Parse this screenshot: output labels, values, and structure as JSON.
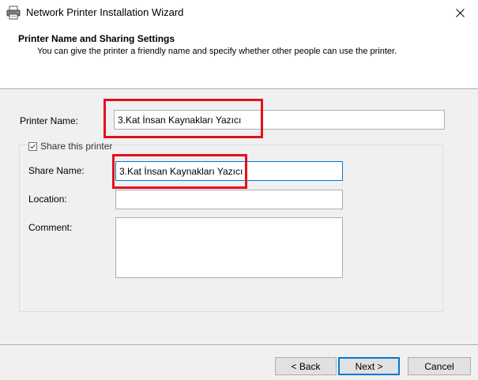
{
  "window": {
    "title": "Network Printer Installation Wizard",
    "icon": "printer-icon",
    "close_icon": "close-icon"
  },
  "header": {
    "title": "Printer Name and Sharing Settings",
    "subtitle": "You can give the printer a friendly name and specify whether other people can use the printer."
  },
  "form": {
    "printer_name_label": "Printer Name:",
    "printer_name_value": "3.Kat İnsan Kaynakları Yazıcı",
    "share_checkbox_label": "Share this printer",
    "share_checked": true,
    "share_name_label": "Share Name:",
    "share_name_value": "3.Kat İnsan Kaynakları Yazıcı",
    "location_label": "Location:",
    "location_value": "",
    "comment_label": "Comment:",
    "comment_value": ""
  },
  "buttons": {
    "back": "< Back",
    "next": "Next >",
    "cancel": "Cancel"
  },
  "colors": {
    "highlight": "#e3101d",
    "focus": "#0078d7"
  }
}
